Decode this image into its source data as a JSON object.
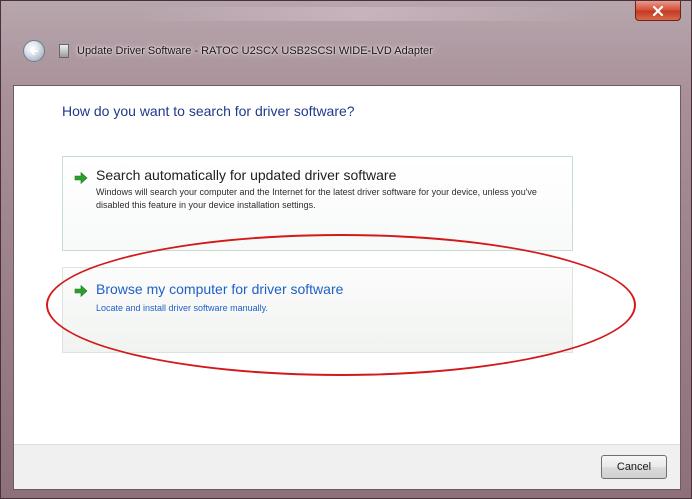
{
  "window": {
    "title": "Update Driver Software - RATOC U2SCX USB2SCSI WIDE-LVD Adapter",
    "close_label": "x"
  },
  "content": {
    "heading": "How do you want to search for driver software?"
  },
  "options": [
    {
      "title": "Search automatically for updated driver software",
      "description": "Windows will search your computer and the Internet for the latest driver software for your device, unless you've disabled this feature in your device installation settings.",
      "icon": "green-arrow-icon"
    },
    {
      "title": "Browse my computer for driver software",
      "description": "Locate and install driver software manually.",
      "icon": "green-arrow-icon"
    }
  ],
  "footer": {
    "cancel_label": "Cancel"
  },
  "colors": {
    "heading": "#1f3a8a",
    "link_blue": "#1f5fc8",
    "arrow_green": "#2ca02c",
    "annotation_red": "#d21a1a"
  }
}
